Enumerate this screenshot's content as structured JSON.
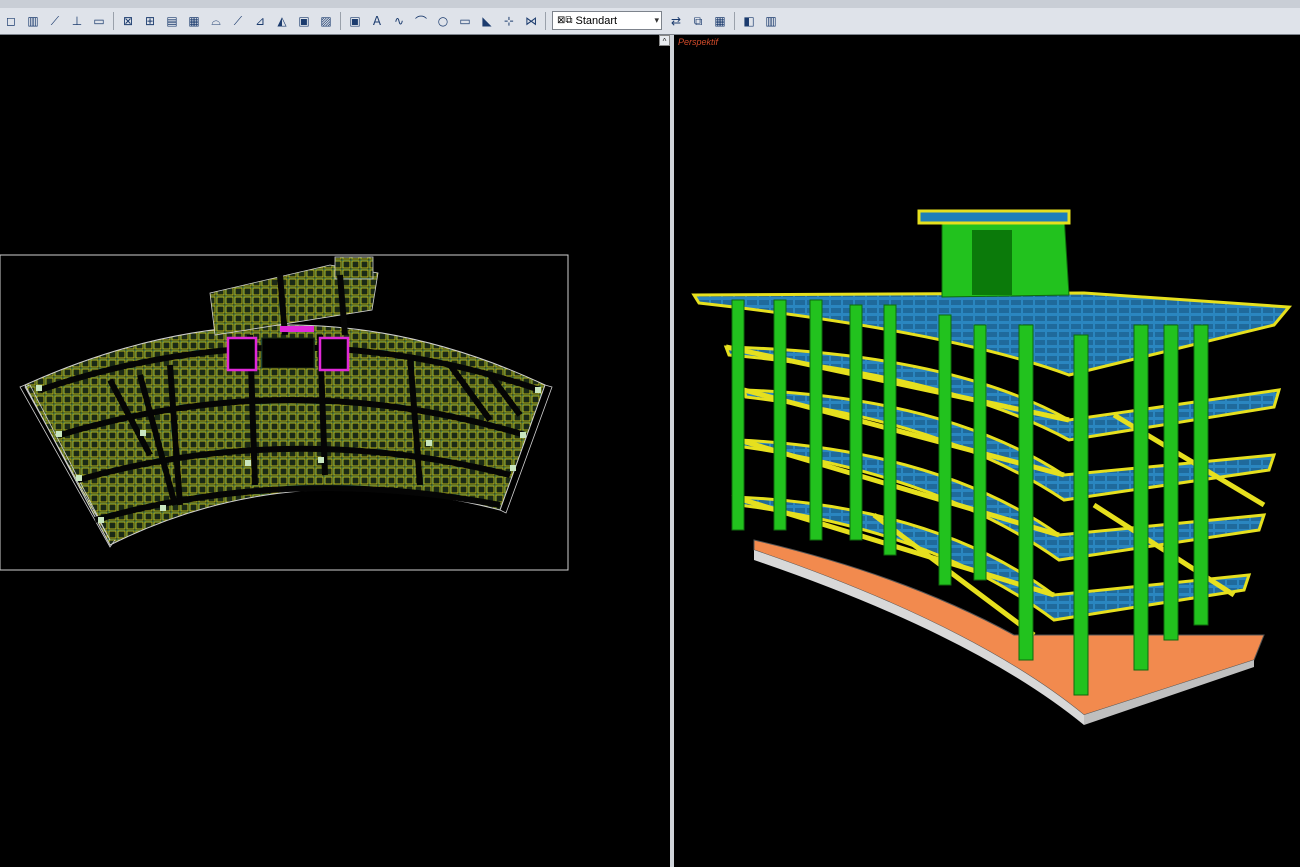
{
  "toolbar": {
    "icons": [
      "select-icon",
      "column-icon",
      "beam-icon",
      "wall-icon",
      "slab-icon",
      "grid-icon",
      "stair-icon",
      "text-icon",
      "line-icon",
      "arc-icon",
      "circle-icon",
      "rect-icon",
      "dimension-icon",
      "layer-icon"
    ],
    "style_selector": {
      "value": "Standart"
    }
  },
  "viewports": {
    "right": {
      "label": "Perspektif"
    }
  },
  "colors": {
    "beam": "#e6e01e",
    "column": "#22c21e",
    "slab": "#1e7fb8",
    "foundation": "#f28a4e",
    "plan_grid": "#2a8a7a",
    "plan_beam": "#d8d020",
    "opening": "#e028d8"
  }
}
